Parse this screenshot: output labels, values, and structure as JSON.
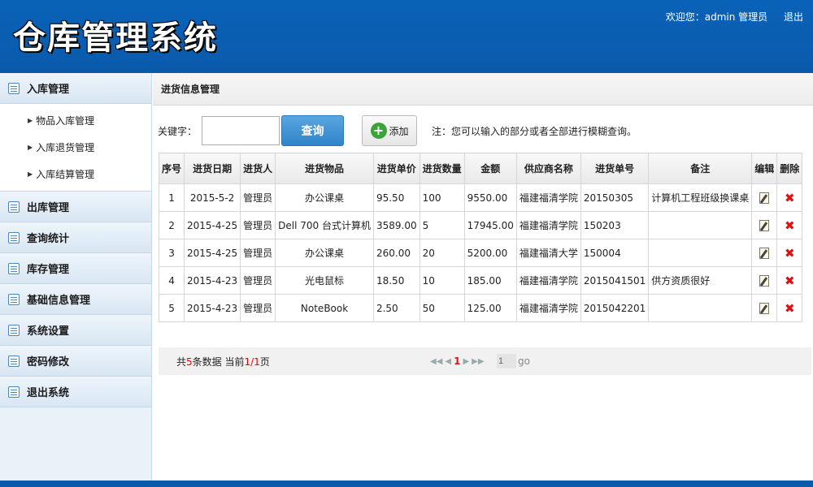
{
  "header": {
    "title": "仓库管理系统",
    "welcome": "欢迎您：admin 管理员",
    "logout": "退出"
  },
  "sidebar": {
    "groups": [
      {
        "label": "入库管理",
        "children": [
          "物品入库管理",
          "入库退货管理",
          "入库结算管理"
        ]
      },
      {
        "label": "出库管理"
      },
      {
        "label": "查询统计"
      },
      {
        "label": "库存管理"
      },
      {
        "label": "基础信息管理"
      },
      {
        "label": "系统设置"
      },
      {
        "label": "密码修改"
      },
      {
        "label": "退出系统"
      }
    ]
  },
  "main": {
    "breadcrumb": "进货信息管理",
    "search": {
      "label": "关键字：",
      "value": "",
      "query_button": "查询",
      "add_button": "添加",
      "note": "注：您可以输入的部分或者全部进行模糊查询。"
    },
    "table": {
      "headers": [
        "序号",
        "进货日期",
        "进货人",
        "进货物品",
        "进货单价",
        "进货数量",
        "金额",
        "供应商名称",
        "进货单号",
        "备注",
        "编辑",
        "删除"
      ],
      "rows": [
        [
          "1",
          "2015-5-2",
          "管理员",
          "办公课桌",
          "95.50",
          "100",
          "9550.00",
          "福建福清学院",
          "20150305",
          "计算机工程班级换课桌"
        ],
        [
          "2",
          "2015-4-25",
          "管理员",
          "Dell 700 台式计算机",
          "3589.00",
          "5",
          "17945.00",
          "福建福清学院",
          "150203",
          ""
        ],
        [
          "3",
          "2015-4-25",
          "管理员",
          "办公课桌",
          "260.00",
          "20",
          "5200.00",
          "福建福清大学",
          "150004",
          ""
        ],
        [
          "4",
          "2015-4-23",
          "管理员",
          "光电鼠标",
          "18.50",
          "10",
          "185.00",
          "福建福清学院",
          "2015041501",
          "供方资质很好"
        ],
        [
          "5",
          "2015-4-23",
          "管理员",
          "NoteBook",
          "2.50",
          "50",
          "125.00",
          "福建福清学院",
          "2015042201",
          ""
        ]
      ]
    },
    "pager": {
      "prefix": "共",
      "total": "5",
      "middle": "条数据 当前",
      "current": "1/1",
      "suffix": "页",
      "page": "1",
      "goto_value": "1",
      "go": "go"
    }
  },
  "colors": {
    "header_bg": "#0a5aab",
    "query_button": "#2f84c9",
    "delete_icon": "#dd1111",
    "add_icon": "#3aa43a"
  },
  "icons": {
    "menu": "list-icon",
    "submenu": "caret-right-icon",
    "add": "plus-circle-icon",
    "edit": "edit-icon",
    "delete": "delete-x-icon"
  }
}
